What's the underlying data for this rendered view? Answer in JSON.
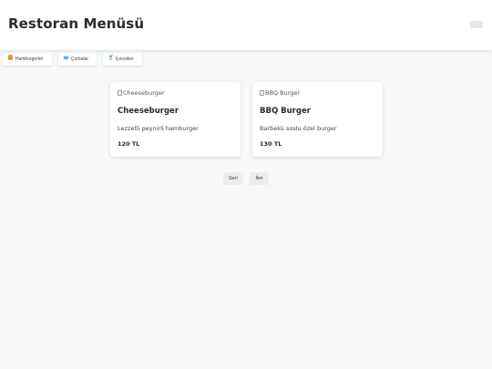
{
  "header": {
    "title": "Restoran Menüsü"
  },
  "categories": [
    {
      "icon": "🍔",
      "icon_name": "burger-icon",
      "label": "Hamburgerler"
    },
    {
      "icon": "🥣",
      "icon_name": "soup-bowl-icon",
      "label": "Çorbalar"
    },
    {
      "icon": "🥤",
      "icon_name": "drink-cup-icon",
      "label": "İçecekler"
    }
  ],
  "items": [
    {
      "image_alt": "Cheeseburger",
      "name": "Cheeseburger",
      "description": "Lezzetli peynirli hamburger",
      "price": "120 TL"
    },
    {
      "image_alt": "BBQ Burger",
      "name": "BBQ Burger",
      "description": "Barbekü soslu özel burger",
      "price": "130 TL"
    }
  ],
  "pagination": {
    "prev_label": "Geri",
    "next_label": "İleri"
  },
  "colors": {
    "page_background": "#f7f8fa",
    "surface": "#ffffff",
    "text": "#2b2b2b",
    "pager_button": "#ececec"
  }
}
